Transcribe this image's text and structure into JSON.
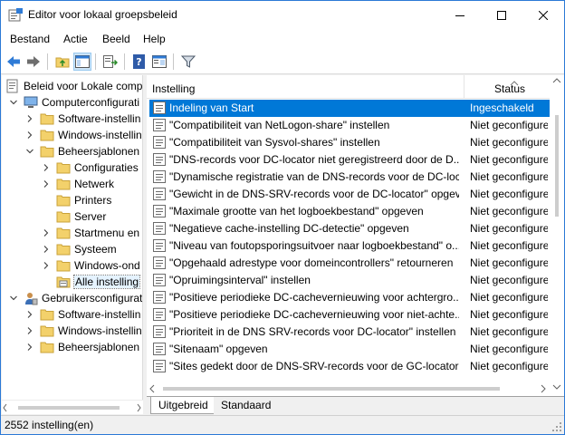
{
  "window": {
    "title": "Editor voor lokaal groepsbeleid"
  },
  "menu": [
    "Bestand",
    "Actie",
    "Beeld",
    "Help"
  ],
  "tree": [
    {
      "label": "Beleid voor Lokale comp",
      "icon": "computer-policy-icon",
      "expander": "none"
    },
    {
      "label": "Computerconfigurati",
      "icon": "computer-icon",
      "expander": "expanded"
    },
    {
      "label": "Software-instellin",
      "icon": "folder-icon",
      "expander": "collapsed"
    },
    {
      "label": "Windows-instellin",
      "icon": "folder-icon",
      "expander": "collapsed"
    },
    {
      "label": "Beheersjablonen",
      "icon": "folder-icon",
      "expander": "expanded"
    },
    {
      "label": "Configuraties",
      "icon": "folder-icon",
      "expander": "collapsed"
    },
    {
      "label": "Netwerk",
      "icon": "folder-icon",
      "expander": "collapsed"
    },
    {
      "label": "Printers",
      "icon": "folder-icon",
      "expander": "none"
    },
    {
      "label": "Server",
      "icon": "folder-icon",
      "expander": "none"
    },
    {
      "label": "Startmenu en",
      "icon": "folder-icon",
      "expander": "collapsed"
    },
    {
      "label": "Systeem",
      "icon": "folder-icon",
      "expander": "collapsed"
    },
    {
      "label": "Windows-ond",
      "icon": "folder-icon",
      "expander": "collapsed"
    },
    {
      "label": "Alle instelling",
      "icon": "settings-folder-icon",
      "expander": "none",
      "selected": true
    },
    {
      "label": "Gebruikersconfigurat",
      "icon": "user-icon",
      "expander": "expanded"
    },
    {
      "label": "Software-instellin",
      "icon": "folder-icon",
      "expander": "collapsed"
    },
    {
      "label": "Windows-instellin",
      "icon": "folder-icon",
      "expander": "collapsed"
    },
    {
      "label": "Beheersjablonen",
      "icon": "folder-icon",
      "expander": "collapsed"
    }
  ],
  "list": {
    "columns": {
      "setting": "Instelling",
      "status": "Status"
    },
    "rows": [
      {
        "name": "Indeling van Start",
        "status": "Ingeschakeld",
        "selected": true
      },
      {
        "name": "\"Compatibiliteit van NetLogon-share\" instellen",
        "status": "Niet geconfigureerd"
      },
      {
        "name": "\"Compatibiliteit van Sysvol-shares\" instellen",
        "status": "Niet geconfigureerd"
      },
      {
        "name": "\"DNS-records voor DC-locator niet geregistreerd door de D...",
        "status": "Niet geconfigureerd"
      },
      {
        "name": "\"Dynamische registratie van de DNS-records voor de DC-loc...",
        "status": "Niet geconfigureerd"
      },
      {
        "name": "\"Gewicht in de DNS-SRV-records voor de DC-locator\" opgev...",
        "status": "Niet geconfigureerd"
      },
      {
        "name": "\"Maximale grootte van het logboekbestand\" opgeven",
        "status": "Niet geconfigureerd"
      },
      {
        "name": "\"Negatieve cache-instelling DC-detectie\" opgeven",
        "status": "Niet geconfigureerd"
      },
      {
        "name": "\"Niveau van foutopsporingsuitvoer naar logboekbestand\" o...",
        "status": "Niet geconfigureerd"
      },
      {
        "name": "\"Opgehaald adrestype voor domeincontrollers\" retourneren",
        "status": "Niet geconfigureerd"
      },
      {
        "name": "\"Opruimingsinterval\" instellen",
        "status": "Niet geconfigureerd"
      },
      {
        "name": "\"Positieve periodieke DC-cachevernieuwing voor achtergro...",
        "status": "Niet geconfigureerd"
      },
      {
        "name": "\"Positieve periodieke DC-cachevernieuwing voor niet-achte...",
        "status": "Niet geconfigureerd"
      },
      {
        "name": "\"Prioriteit in de DNS SRV-records voor DC-locator\" instellen",
        "status": "Niet geconfigureerd"
      },
      {
        "name": "\"Sitenaam\" opgeven",
        "status": "Niet geconfigureerd"
      },
      {
        "name": "\"Sites gedekt door de DNS-SRV-records voor de GC-locator\"...",
        "status": "Niet geconfigureerd"
      }
    ]
  },
  "tabs": {
    "extended": "Uitgebreid",
    "standard": "Standaard"
  },
  "statusbar": {
    "text": "2552 instelling(en)"
  },
  "colors": {
    "accent": "#0078d7",
    "selection_bg": "#0078d7",
    "folder": "#f3d16b"
  }
}
